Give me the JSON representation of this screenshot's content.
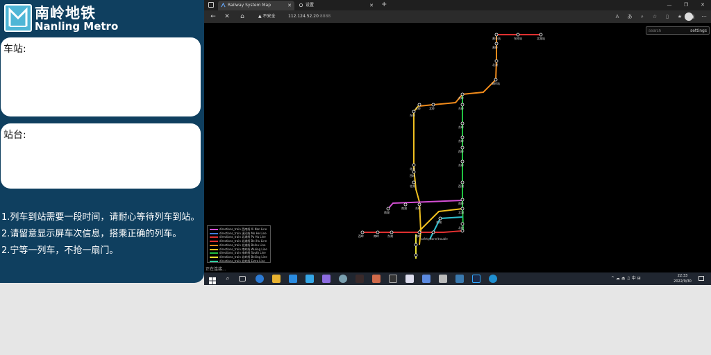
{
  "panel": {
    "brand_cn": "南岭地铁",
    "brand_en": "Nanling Metro",
    "station_label": "车站:",
    "platform_label": "站台:",
    "notices": [
      "1.列车到站需要一段时间，请耐心等待列车到站。",
      "2.请留意显示屏车次信息，搭乘正确的列车。",
      "2.宁等一列车，不抢一扇门。"
    ]
  },
  "browser": {
    "tabs": [
      {
        "label": "Railway System Map",
        "icon": "map-icon"
      },
      {
        "label": "设置",
        "icon": "gear-icon"
      }
    ],
    "new_tab": "+",
    "security_text": "不安全",
    "url_host": "112.124.52.20",
    "url_port": ":8888",
    "search_placeholder": "search",
    "settings_label": "settings",
    "status": "正在连接...",
    "window_controls": [
      "—",
      "❐",
      "✕"
    ]
  },
  "legend": [
    {
      "text": "directions_train 西南线 Xi Nan Line",
      "color": "#d54fd5"
    },
    {
      "text": "directions_train 漠河线 Mo He Line",
      "color": "#3f7bd9"
    },
    {
      "text": "directions_train 北湖线 Pu Hu Line",
      "color": "#e03030"
    },
    {
      "text": "directions_train 北湖线 Bei Hu Line",
      "color": "#e03030"
    },
    {
      "text": "directions_train 北湖线 Beihu Line",
      "color": "#f08a1a"
    },
    {
      "text": "directions_train 南岭线 Wuling Line",
      "color": "#f0c020"
    },
    {
      "text": "directions_train 南岭线 South Line",
      "color": "#20c040"
    },
    {
      "text": "directions_train 北岭线 Beiling Line",
      "color": "#e8e030"
    },
    {
      "text": "directions_train 北岭线 Extra Line",
      "color": "#30d0a0"
    }
  ],
  "map": {
    "station_labels": [
      "黄金站",
      "东岭站",
      "北湖站",
      "黄岭",
      "北湖",
      "高岭站",
      "东岭",
      "北岭",
      "东岭",
      "东岭",
      "东岭",
      "东岭",
      "东岭",
      "西岭",
      "花湖",
      "西岭",
      "北湖",
      "东岭",
      "西湖",
      "南岭",
      "南湖",
      "南湖",
      "东岭",
      "北湖",
      "东湖",
      "北岭",
      "西岭",
      "南岭",
      "东湖",
      "南岭"
    ],
    "center_label": "safety/zone/trouble"
  },
  "taskbar": {
    "time": "22:33",
    "date": "2022/9/30",
    "ime": "中",
    "tray_text": "^ ☁ ⏏ ♫ 中 ⊞"
  },
  "colors": {
    "panel_bg": "#0f3f5f",
    "logo_bg": "#4fb6d6",
    "line_orange": "#f08a1a",
    "line_green": "#20c040",
    "line_yellow": "#f0c020",
    "line_red": "#e03030",
    "line_magenta": "#d54fd5",
    "line_cyan": "#30c0d0"
  }
}
